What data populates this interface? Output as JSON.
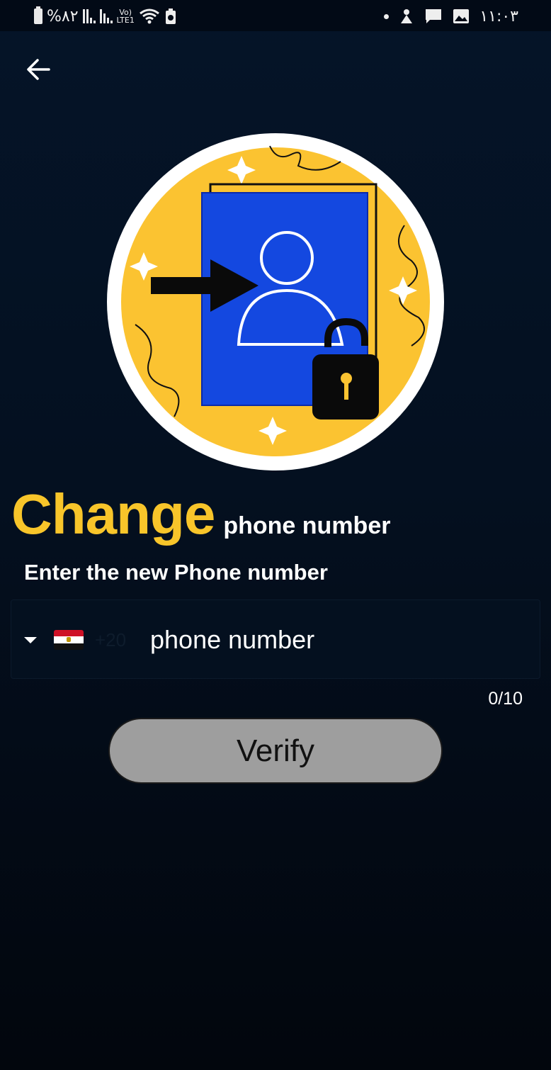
{
  "status_bar": {
    "battery_percent": "%٨٢",
    "network_volte": "Vo)",
    "network_lte": "LTE1",
    "time": "١١:٠٣"
  },
  "icons": {
    "back": "arrow-left-icon",
    "illustration": "profile-lock-illustration"
  },
  "header": {
    "title_main": "Change",
    "title_sub": "phone number"
  },
  "form": {
    "instruction": "Enter the new Phone number",
    "country_flag": "egypt-flag-icon",
    "dial_code": "+20",
    "phone_placeholder": "phone number",
    "phone_value": "",
    "char_counter": "0/10",
    "verify_label": "Verify"
  },
  "colors": {
    "accent_yellow": "#f8c52a",
    "illustration_blue": "#1448e0",
    "button_gray": "#9e9e9e",
    "background": "#041020"
  }
}
